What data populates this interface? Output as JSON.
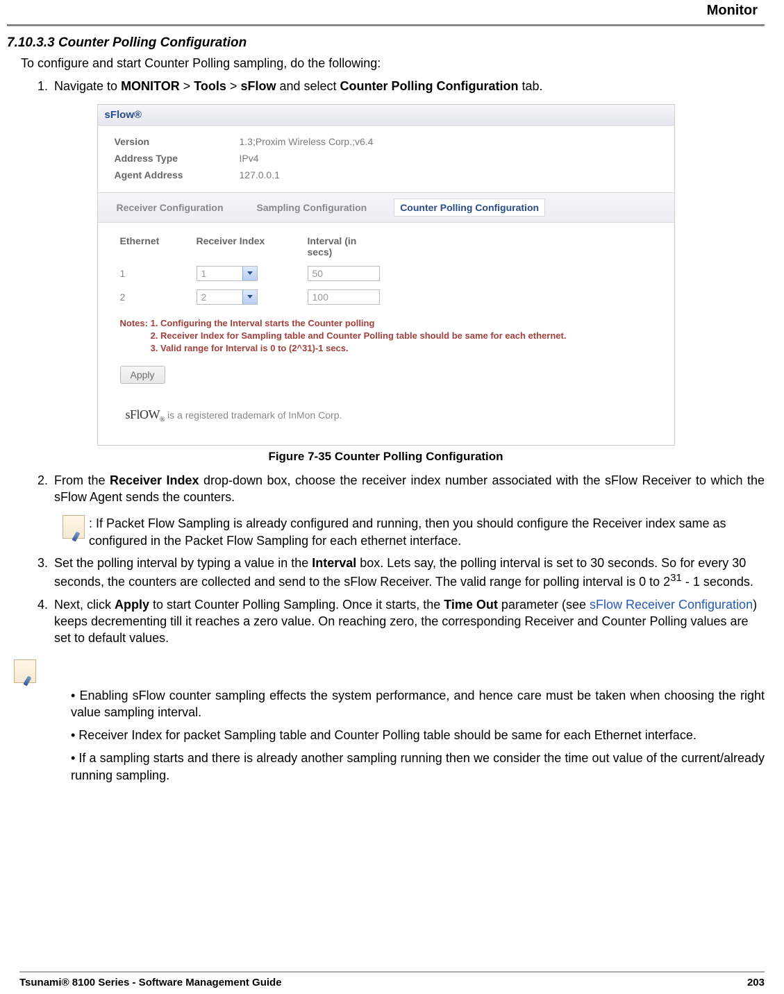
{
  "header": {
    "chapter": "Monitor"
  },
  "section": {
    "number": "7.10.3.3",
    "title": "Counter Polling Configuration",
    "intro": "To configure and start Counter Polling sampling, do the following:"
  },
  "steps": {
    "s1": {
      "pre": "Navigate to ",
      "nav1": "MONITOR",
      "sep": " > ",
      "nav2": "Tools",
      "nav3": "sFlow",
      "mid": " and select ",
      "tab": "Counter Polling Configuration",
      "post": " tab."
    },
    "s2": {
      "pre": "From the ",
      "field": "Receiver Index",
      "post": " drop-down box, choose the receiver index number associated with the sFlow Receiver to which the sFlow Agent sends the counters."
    },
    "s3": {
      "pre": "Set the polling interval by typing a value in the ",
      "field": "Interval",
      "mid": " box. Lets say, the polling interval is set to 30 seconds. So for every 30 seconds, the counters are collected and send to the sFlow Receiver. The valid range for polling interval is 0 to 2",
      "exp": "31",
      "post": " - 1 seconds."
    },
    "s4": {
      "pre": "Next, click ",
      "apply": "Apply",
      "mid1": " to start Counter Polling Sampling. Once it starts, the ",
      "timeout": "Time Out",
      "mid2": " parameter (see ",
      "link": "sFlow Receiver Configuration",
      "post": ") keeps decrementing till it reaches a zero value. On reaching zero, the corresponding Receiver and Counter Polling values are set to default values."
    }
  },
  "inline_note": ": If Packet Flow Sampling is already configured and running, then you should configure the Receiver index same as configured in the Packet Flow Sampling for each ethernet interface.",
  "final_notes": {
    "b1": "• Enabling sFlow counter sampling effects the system performance, and hence care must be taken when choosing the right value sampling interval.",
    "b2": "• Receiver Index for packet Sampling table and Counter Polling table should be same for each Ethernet interface.",
    "b3": "• If a sampling starts and there is already another sampling running then we consider the time out value of the current/already running sampling."
  },
  "figure": {
    "caption": "Figure 7-35 Counter Polling Configuration"
  },
  "panel": {
    "title": "sFlow®",
    "info": {
      "version_label": "Version",
      "version_value": "1.3;Proxim Wireless Corp.;v6.4",
      "addrtype_label": "Address Type",
      "addrtype_value": "IPv4",
      "agentaddr_label": "Agent Address",
      "agentaddr_value": "127.0.0.1"
    },
    "tabs": {
      "t1": "Receiver Configuration",
      "t2": "Sampling Configuration",
      "t3": "Counter Polling Configuration"
    },
    "columns": {
      "eth": "Ethernet",
      "ri": "Receiver Index",
      "int": "Interval (in secs)"
    },
    "rows": [
      {
        "eth": "1",
        "ri": "1",
        "int": "50"
      },
      {
        "eth": "2",
        "ri": "2",
        "int": "100"
      }
    ],
    "notes": {
      "lead": "Notes:",
      "n1": "1. Configuring the Interval starts the Counter polling",
      "n2": "2. Receiver Index for Sampling table and Counter Polling table should be same for each ethernet.",
      "n3": "3. Valid range for Interval is 0 to (2^31)-1 secs."
    },
    "apply": "Apply",
    "trademark_suffix": " is a registered trademark of InMon Corp."
  },
  "footer": {
    "left": "Tsunami® 8100 Series - Software Management Guide",
    "right": "203"
  }
}
